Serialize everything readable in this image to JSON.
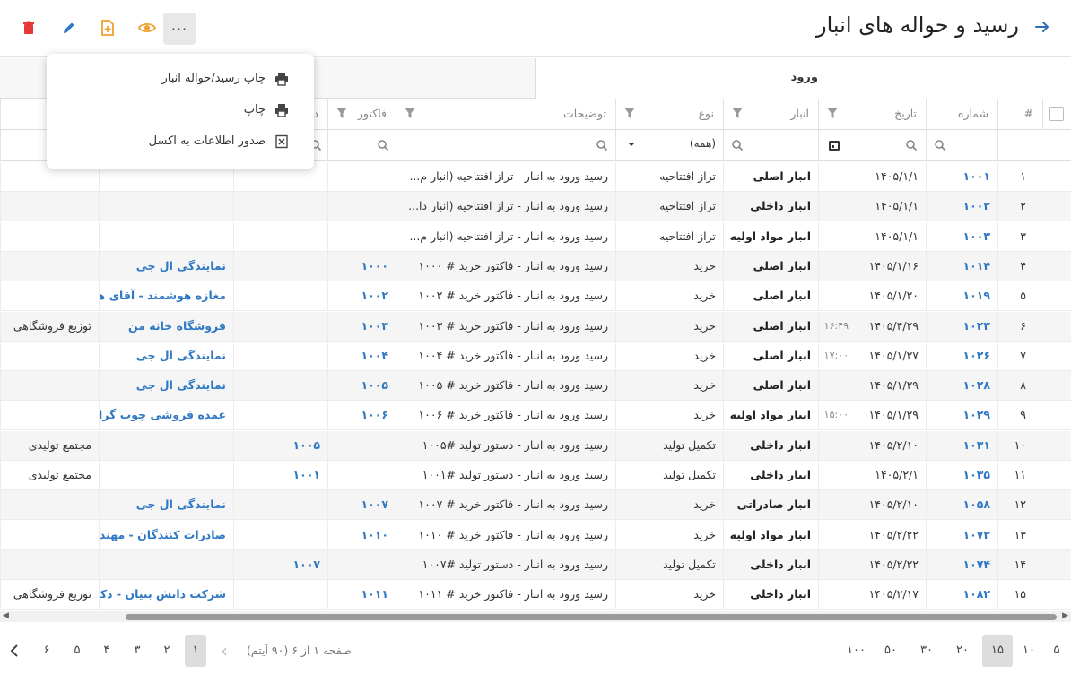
{
  "header": {
    "title": "رسید و حواله های انبار",
    "more_label": "···"
  },
  "toolbar_icons": [
    "arrow-right-icon",
    "more-icon",
    "eye-icon",
    "add-file-icon",
    "edit-icon",
    "delete-icon"
  ],
  "colors": {
    "accent": "#2e78c4",
    "warning": "#f0a030",
    "danger": "#e53935"
  },
  "menu": {
    "items": [
      {
        "label": "چاپ رسید/حواله انبار",
        "icon": "printer-icon"
      },
      {
        "label": "چاپ",
        "icon": "printer-icon"
      },
      {
        "label": "صدور اطلاعات به اکسل",
        "icon": "excel-icon"
      }
    ]
  },
  "group": {
    "label": "ورود"
  },
  "columns": {
    "index": "#",
    "number": "شماره",
    "date": "تاریخ",
    "warehouse": "انبار",
    "type": "نوع",
    "description": "توضیحات",
    "invoice": "فاکتور",
    "partial": "د"
  },
  "filters": {
    "type_value": "(همه)"
  },
  "rows": [
    {
      "idx": "۱",
      "num": "۱۰۰۱",
      "date": "۱۴۰۵/۱/۱",
      "time": "",
      "wh": "انبار اصلی",
      "type": "تراز افتتاحیه",
      "desc": "رسید ورود به انبار - تراز افتتاحیه (انبار م...",
      "invoice": "",
      "order": "",
      "party": "",
      "group": ""
    },
    {
      "idx": "۲",
      "num": "۱۰۰۲",
      "date": "۱۴۰۵/۱/۱",
      "time": "",
      "wh": "انبار داخلی",
      "type": "تراز افتتاحیه",
      "desc": "رسید ورود به انبار - تراز افتتاحیه (انبار دا...",
      "invoice": "",
      "order": "",
      "party": "",
      "group": ""
    },
    {
      "idx": "۳",
      "num": "۱۰۰۳",
      "date": "۱۴۰۵/۱/۱",
      "time": "",
      "wh": "انبار مواد اولیه",
      "type": "تراز افتتاحیه",
      "desc": "رسید ورود به انبار - تراز افتتاحیه (انبار م...",
      "invoice": "",
      "order": "",
      "party": "",
      "group": ""
    },
    {
      "idx": "۴",
      "num": "۱۰۱۴",
      "date": "۱۴۰۵/۱/۱۶",
      "time": "",
      "wh": "انبار اصلی",
      "type": "خرید",
      "desc": "رسید ورود به انبار - فاکتور خرید # ۱۰۰۰",
      "invoice": "۱۰۰۰",
      "order": "",
      "party": "نمایندگی ال جی",
      "group": ""
    },
    {
      "idx": "۵",
      "num": "۱۰۱۹",
      "date": "۱۴۰۵/۱/۲۰",
      "time": "",
      "wh": "انبار اصلی",
      "type": "خرید",
      "desc": "رسید ورود به انبار - فاکتور خرید # ۱۰۰۲",
      "invoice": "۱۰۰۲",
      "order": "",
      "party": "مغازه هوشمند - آقای هوشمند",
      "group": ""
    },
    {
      "idx": "۶",
      "num": "۱۰۲۳",
      "date": "۱۴۰۵/۴/۲۹",
      "time": "۱۶:۴۹",
      "wh": "انبار اصلی",
      "type": "خرید",
      "desc": "رسید ورود به انبار - فاکتور خرید # ۱۰۰۳",
      "invoice": "۱۰۰۳",
      "order": "",
      "party": "فروشگاه خانه من",
      "group": "توزیع فروشگاهی"
    },
    {
      "idx": "۷",
      "num": "۱۰۲۶",
      "date": "۱۴۰۵/۱/۲۷",
      "time": "۱۷:۰۰",
      "wh": "انبار اصلی",
      "type": "خرید",
      "desc": "رسید ورود به انبار - فاکتور خرید # ۱۰۰۴",
      "invoice": "۱۰۰۴",
      "order": "",
      "party": "نمایندگی ال جی",
      "group": ""
    },
    {
      "idx": "۸",
      "num": "۱۰۲۸",
      "date": "۱۴۰۵/۱/۲۹",
      "time": "",
      "wh": "انبار اصلی",
      "type": "خرید",
      "desc": "رسید ورود به انبار - فاکتور خرید # ۱۰۰۵",
      "invoice": "۱۰۰۵",
      "order": "",
      "party": "نمایندگی ال جی",
      "group": ""
    },
    {
      "idx": "۹",
      "num": "۱۰۲۹",
      "date": "۱۴۰۵/۱/۲۹",
      "time": "۱۵:۰۰",
      "wh": "انبار مواد اولیه",
      "type": "خرید",
      "desc": "رسید ورود به انبار - فاکتور خرید # ۱۰۰۶",
      "invoice": "۱۰۰۶",
      "order": "",
      "party": "عمده فروشی چوب گرامی",
      "group": ""
    },
    {
      "idx": "۱۰",
      "num": "۱۰۳۱",
      "date": "۱۴۰۵/۲/۱۰",
      "time": "",
      "wh": "انبار داخلی",
      "type": "تکمیل تولید",
      "desc": "رسید ورود به انبار - دستور تولید #۱۰۰۵",
      "invoice": "",
      "order": "۱۰۰۵",
      "party": "",
      "group": "مجتمع تولیدی"
    },
    {
      "idx": "۱۱",
      "num": "۱۰۳۵",
      "date": "۱۴۰۵/۲/۱",
      "time": "",
      "wh": "انبار داخلی",
      "type": "تکمیل تولید",
      "desc": "رسید ورود به انبار - دستور تولید #۱۰۰۱",
      "invoice": "",
      "order": "۱۰۰۱",
      "party": "",
      "group": "مجتمع تولیدی"
    },
    {
      "idx": "۱۲",
      "num": "۱۰۵۸",
      "date": "۱۴۰۵/۲/۱۰",
      "time": "",
      "wh": "انبار صادراتی",
      "type": "خرید",
      "desc": "رسید ورود به انبار - فاکتور خرید # ۱۰۰۷",
      "invoice": "۱۰۰۷",
      "order": "",
      "party": "نمایندگی ال جی",
      "group": ""
    },
    {
      "idx": "۱۳",
      "num": "۱۰۷۲",
      "date": "۱۴۰۵/۲/۲۲",
      "time": "",
      "wh": "انبار مواد اولیه",
      "type": "خرید",
      "desc": "رسید ورود به انبار - فاکتور خرید # ۱۰۱۰",
      "invoice": "۱۰۱۰",
      "order": "",
      "party": "صادرات کنندگان - مهندس صادقی",
      "group": ""
    },
    {
      "idx": "۱۴",
      "num": "۱۰۷۴",
      "date": "۱۴۰۵/۲/۲۲",
      "time": "",
      "wh": "انبار داخلی",
      "type": "تکمیل تولید",
      "desc": "رسید ورود به انبار - دستور تولید #۱۰۰۷",
      "invoice": "",
      "order": "۱۰۰۷",
      "party": "",
      "group": ""
    },
    {
      "idx": "۱۵",
      "num": "۱۰۸۲",
      "date": "۱۴۰۵/۲/۱۷",
      "time": "",
      "wh": "انبار داخلی",
      "type": "خرید",
      "desc": "رسید ورود به انبار - فاکتور خرید # ۱۰۱۱",
      "invoice": "۱۰۱۱",
      "order": "",
      "party": "شرکت دانش بنیان - دکتر مهندس",
      "group": "توزیع فروشگاهی"
    }
  ],
  "pager": {
    "sizes": [
      "۵",
      "۱۰",
      "۱۵",
      "۲۰",
      "۳۰",
      "۵۰",
      "۱۰۰"
    ],
    "selected_size": "۱۵",
    "info": "صفحه ۱ از ۶ (۹۰ آیتم)",
    "pages": [
      "۱",
      "۲",
      "۳",
      "۴",
      "۵",
      "۶"
    ],
    "current_page": "۱",
    "prev_label": "‹",
    "next_label": "‹"
  }
}
